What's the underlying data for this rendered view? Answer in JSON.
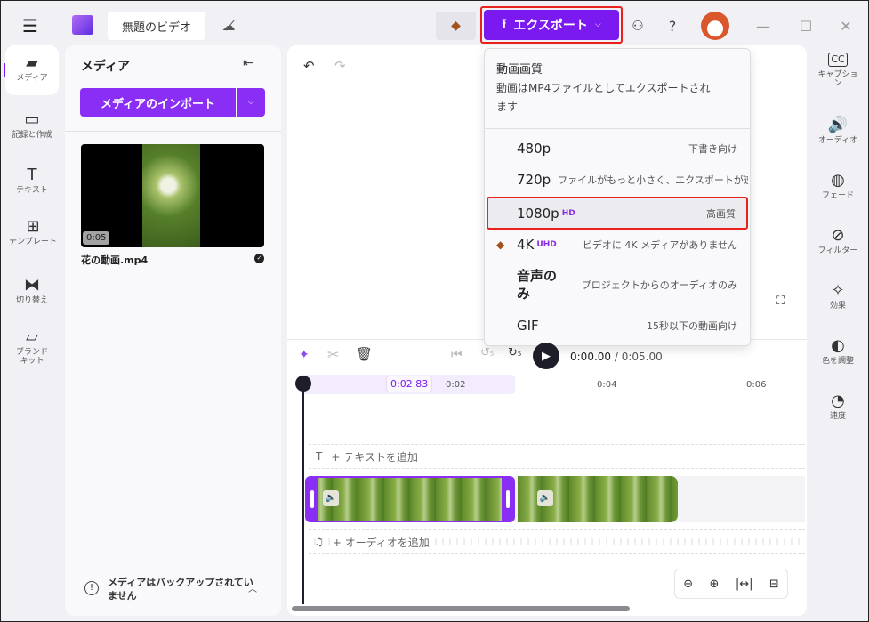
{
  "header": {
    "title": "無題のビデオ",
    "export_label": "エクスポート",
    "help": "?"
  },
  "nav": [
    {
      "label": "メディア"
    },
    {
      "label": "記録と作成"
    },
    {
      "label": "テキスト"
    },
    {
      "label": "テンプレート"
    },
    {
      "label": "切り替え"
    },
    {
      "label": "ブランドキット"
    }
  ],
  "media": {
    "title": "メディア",
    "import_label": "メディアのインポート",
    "file_name": "花の動画.mp4",
    "duration": "0:05",
    "backup_notice": "メディアはバックアップされていません"
  },
  "export_menu": {
    "title": "動画画質",
    "subtitle": "動画はMP4ファイルとしてエクスポートされます",
    "options": [
      {
        "label": "480p",
        "badge": "",
        "desc": "下書き向け"
      },
      {
        "label": "720p",
        "badge": "",
        "desc": "ファイルがもっと小さく、エクスポートが速い"
      },
      {
        "label": "1080p",
        "badge": "HD",
        "desc": "高画質",
        "selected": true
      },
      {
        "label": "4K",
        "badge": "UHD",
        "desc": "ビデオに 4K メディアがありません",
        "premium": true
      },
      {
        "label": "音声のみ",
        "badge": "",
        "desc": "プロジェクトからのオーディオのみ"
      },
      {
        "label": "GIF",
        "badge": "",
        "desc": "15秒以下の動画向け"
      }
    ]
  },
  "timeline": {
    "current_time": "0:00.00",
    "total_time": "/ 0:05.00",
    "playhead": "0:02.83",
    "ticks": [
      "0:02",
      "0:04",
      "0:06"
    ],
    "add_text": "+ テキストを追加",
    "add_audio": "+ オーディオを追加",
    "skip": "5"
  },
  "rail": [
    {
      "label": "キャプション"
    },
    {
      "label": "オーディオ"
    },
    {
      "label": "フェード"
    },
    {
      "label": "フィルター"
    },
    {
      "label": "効果"
    },
    {
      "label": "色を調整"
    },
    {
      "label": "速度"
    }
  ],
  "colors": {
    "accent": "#7b1af0",
    "highlight": "#e8221d"
  }
}
